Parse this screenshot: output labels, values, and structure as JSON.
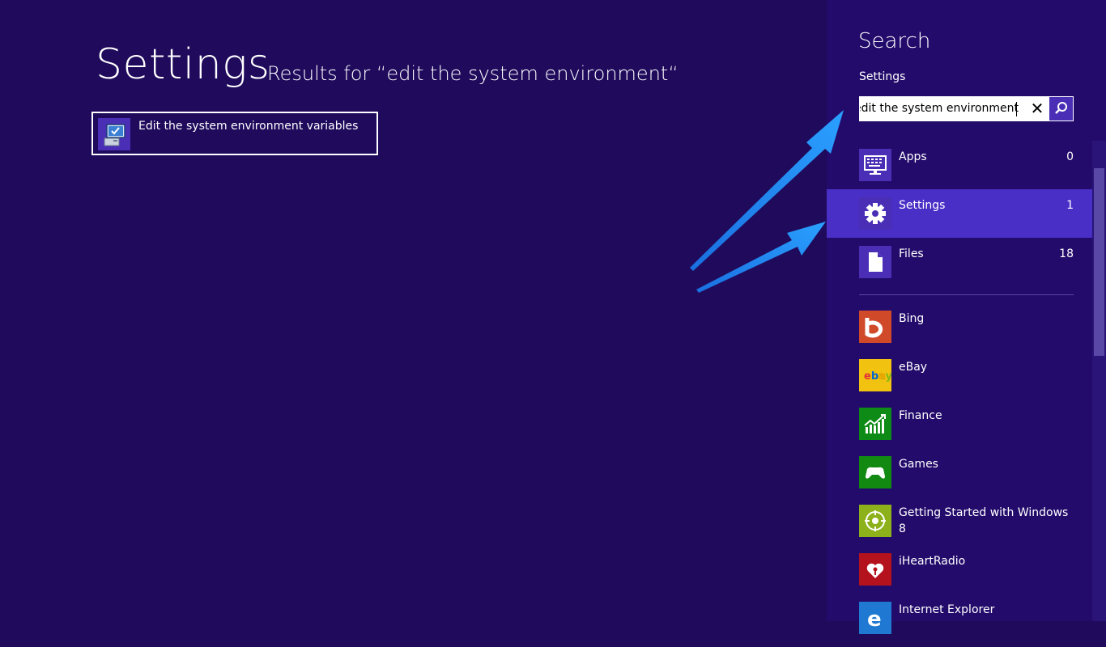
{
  "main": {
    "title": "Settings",
    "subtitle": "Results for “edit the system environment“",
    "results": [
      {
        "label": "Edit the system environment variables",
        "icon": "system-properties-icon"
      }
    ]
  },
  "search_pane": {
    "title": "Search",
    "scope": "Settings",
    "query": "edit the system environment",
    "clear_icon": "✕",
    "categories": [
      {
        "label": "Apps",
        "count": "0",
        "icon": "apps-keyboard-icon"
      },
      {
        "label": "Settings",
        "count": "1",
        "icon": "gear-icon"
      },
      {
        "label": "Files",
        "count": "18",
        "icon": "file-icon"
      }
    ],
    "apps": [
      {
        "label": "Bing",
        "icon": "bing-icon",
        "color": "#d04a2a"
      },
      {
        "label": "eBay",
        "icon": "ebay-icon",
        "color": "#f1c20f"
      },
      {
        "label": "Finance",
        "icon": "finance-icon",
        "color": "#0e8a16"
      },
      {
        "label": "Games",
        "icon": "games-icon",
        "color": "#128a12"
      },
      {
        "label": "Getting Started with Windows 8",
        "icon": "compass-icon",
        "color": "#8cb11a"
      },
      {
        "label": "iHeartRadio",
        "icon": "iheartradio-icon",
        "color": "#b4121c"
      },
      {
        "label": "Internet Explorer",
        "icon": "internet-explorer-icon",
        "color": "#1f78d1"
      }
    ]
  },
  "colors": {
    "background": "#1f0a5c",
    "pane": "#230b6b",
    "accent": "#4a2fb6",
    "selected": "#4a2fc6",
    "annotation_arrow": "#1e90ff"
  }
}
